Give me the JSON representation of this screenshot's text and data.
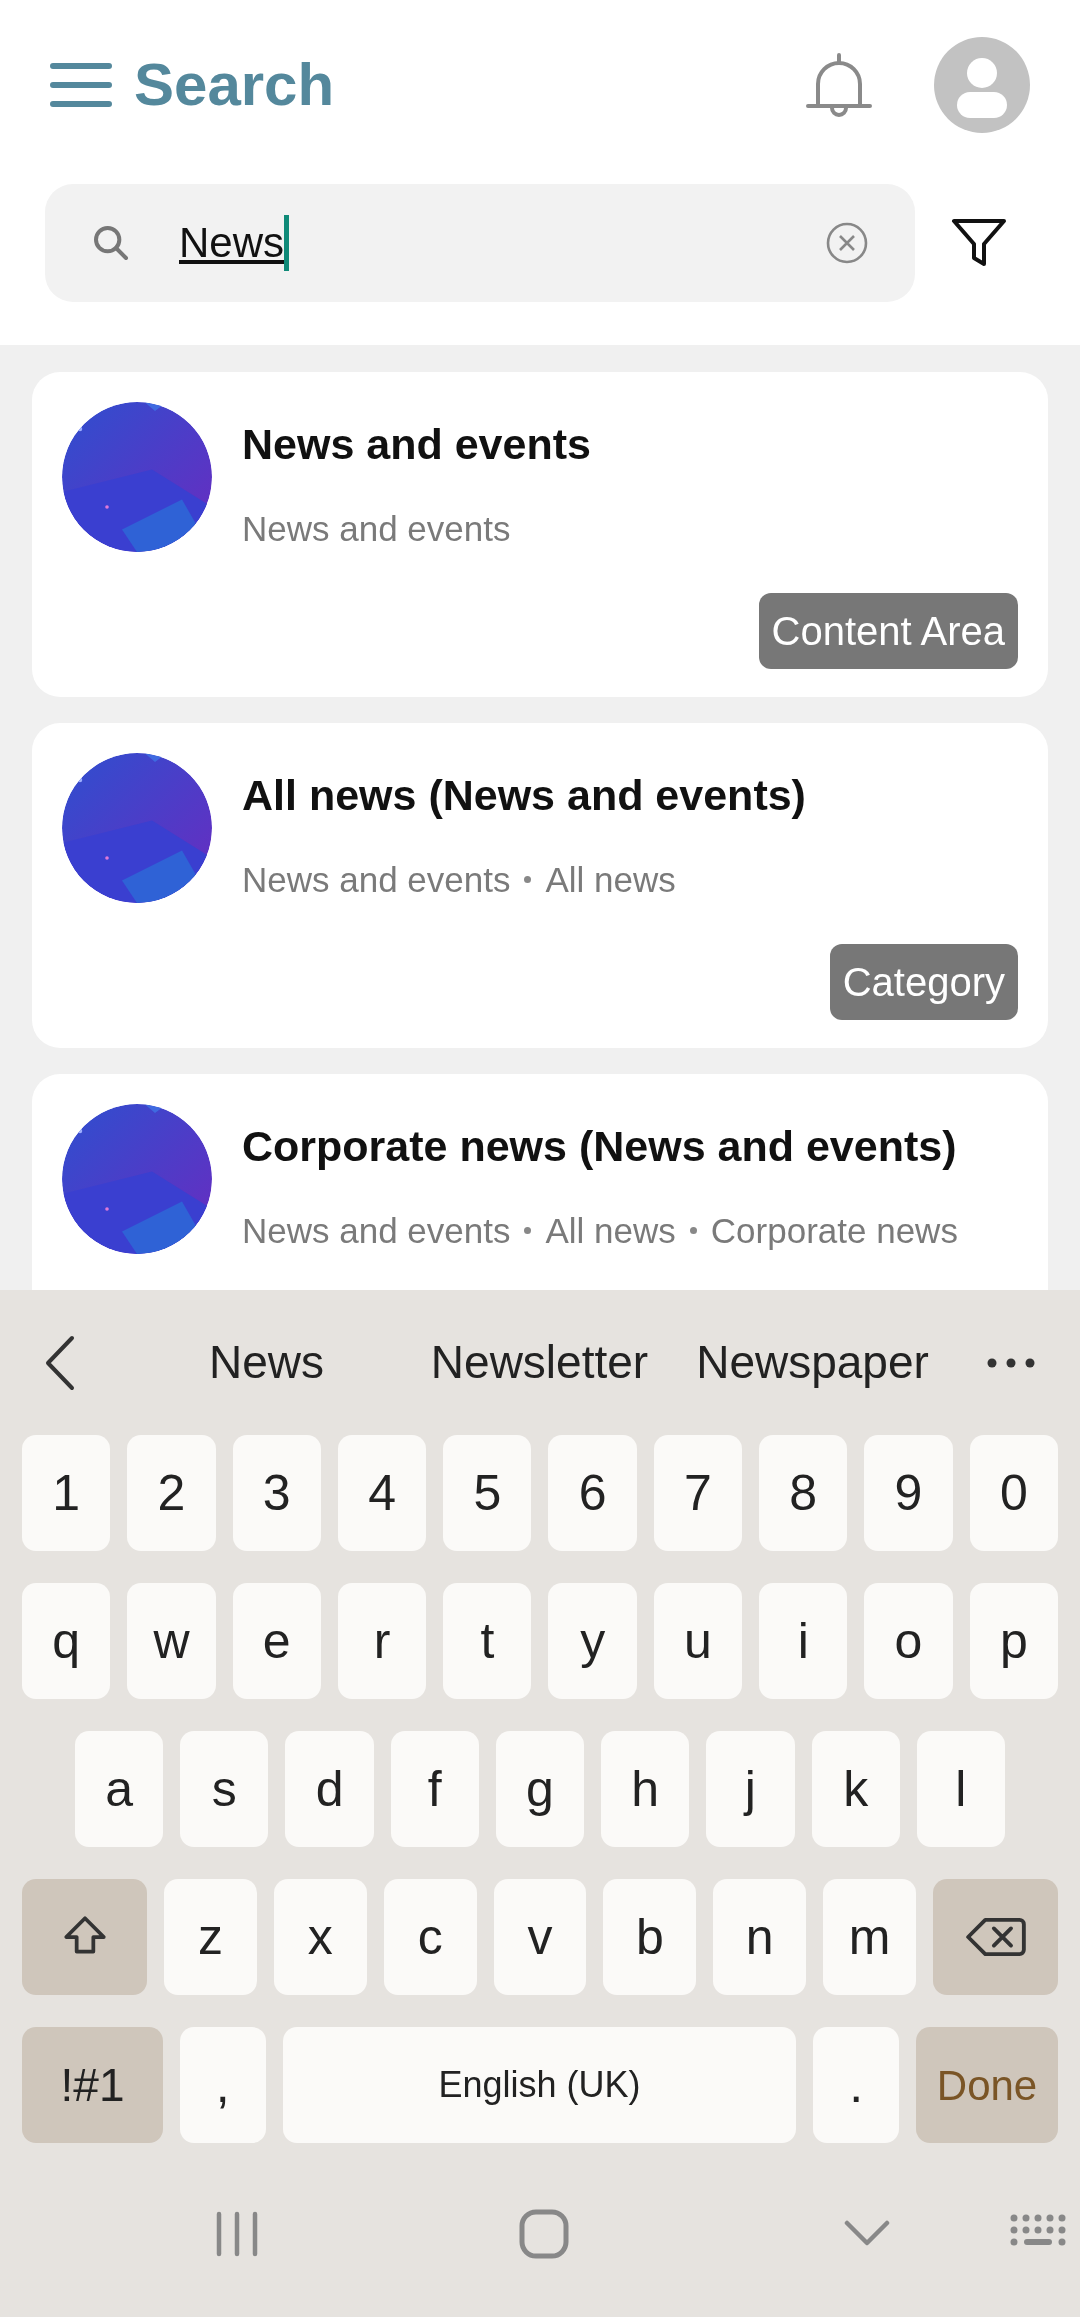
{
  "header": {
    "title": "Search"
  },
  "search": {
    "value": "News"
  },
  "results": [
    {
      "title": "News and events",
      "path": [
        "News and events"
      ],
      "badge": "Content Area"
    },
    {
      "title": "All news (News and events)",
      "path": [
        "News and events",
        "All news"
      ],
      "badge": "Category"
    },
    {
      "title": "Corporate news (News and events)",
      "path": [
        "News and events",
        "All news",
        "Corporate news"
      ]
    }
  ],
  "keyboard": {
    "suggestions": [
      "News",
      "Newsletter",
      "Newspaper"
    ],
    "key_rows": [
      [
        {
          "kind": "char",
          "label": "1"
        },
        {
          "kind": "char",
          "label": "2"
        },
        {
          "kind": "char",
          "label": "3"
        },
        {
          "kind": "char",
          "label": "4"
        },
        {
          "kind": "char",
          "label": "5"
        },
        {
          "kind": "char",
          "label": "6"
        },
        {
          "kind": "char",
          "label": "7"
        },
        {
          "kind": "char",
          "label": "8"
        },
        {
          "kind": "char",
          "label": "9"
        },
        {
          "kind": "char",
          "label": "0"
        }
      ],
      [
        {
          "kind": "char",
          "label": "q"
        },
        {
          "kind": "char",
          "label": "w"
        },
        {
          "kind": "char",
          "label": "e"
        },
        {
          "kind": "char",
          "label": "r"
        },
        {
          "kind": "char",
          "label": "t"
        },
        {
          "kind": "char",
          "label": "y"
        },
        {
          "kind": "char",
          "label": "u"
        },
        {
          "kind": "char",
          "label": "i"
        },
        {
          "kind": "char",
          "label": "o"
        },
        {
          "kind": "char",
          "label": "p"
        }
      ],
      [
        {
          "kind": "char",
          "label": "a"
        },
        {
          "kind": "char",
          "label": "s"
        },
        {
          "kind": "char",
          "label": "d"
        },
        {
          "kind": "char",
          "label": "f"
        },
        {
          "kind": "char",
          "label": "g"
        },
        {
          "kind": "char",
          "label": "h"
        },
        {
          "kind": "char",
          "label": "j"
        },
        {
          "kind": "char",
          "label": "k"
        },
        {
          "kind": "char",
          "label": "l"
        }
      ],
      [
        {
          "kind": "shift"
        },
        {
          "kind": "char",
          "label": "z"
        },
        {
          "kind": "char",
          "label": "x"
        },
        {
          "kind": "char",
          "label": "c"
        },
        {
          "kind": "char",
          "label": "v"
        },
        {
          "kind": "char",
          "label": "b"
        },
        {
          "kind": "char",
          "label": "n"
        },
        {
          "kind": "char",
          "label": "m"
        },
        {
          "kind": "backspace"
        }
      ],
      [
        {
          "kind": "symbols",
          "label": "!#1"
        },
        {
          "kind": "char",
          "label": ","
        },
        {
          "kind": "space",
          "label": "English (UK)"
        },
        {
          "kind": "char",
          "label": "."
        },
        {
          "kind": "done",
          "label": "Done"
        }
      ]
    ]
  }
}
